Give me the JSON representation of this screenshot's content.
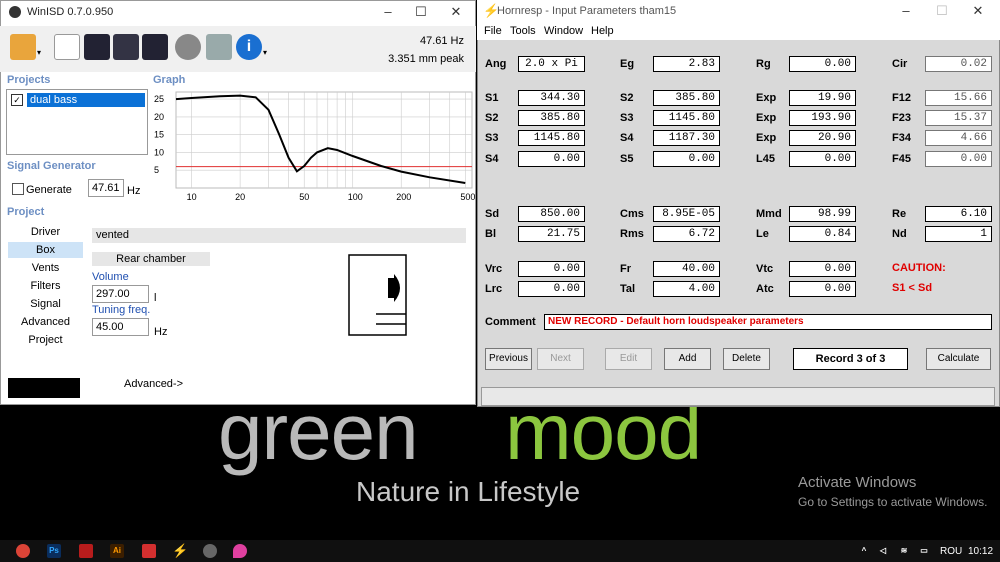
{
  "desktop": {
    "brand_grey": "green",
    "brand_green": "mood",
    "tagline": "Nature in Lifestyle",
    "activate_title": "Activate Windows",
    "activate_sub": "Go to Settings to activate Windows.",
    "accent_green": "#8cc63f"
  },
  "taskbar": {
    "language": "ROU",
    "time": "10:12",
    "icons": [
      "chrome-icon",
      "photoshop-icon",
      "autocad-icon",
      "illustrator-icon",
      "acrobat-icon",
      "hornresp-icon",
      "winisd-icon",
      "maps-icon"
    ]
  },
  "winisd": {
    "title": "WinISD 0.7.0.950",
    "freq_readout": "47.61 Hz",
    "peak_readout": "3.351 mm peak",
    "projects_label": "Projects",
    "graph_label": "Graph",
    "project_name": "dual bass",
    "signal_generator_label": "Signal Generator",
    "generate_label": "Generate",
    "generator_value": "47.61",
    "generator_unit": "Hz",
    "project_label": "Project",
    "nav": [
      "Driver",
      "Box",
      "Vents",
      "Filters",
      "Signal",
      "Advanced",
      "Project"
    ],
    "box_type": "vented",
    "rear_chamber": "Rear chamber",
    "volume_label": "Volume",
    "volume_value": "297.00",
    "volume_unit": "l",
    "tuning_label": "Tuning freq.",
    "tuning_value": "45.00",
    "tuning_unit": "Hz",
    "advanced_link": "Advanced->",
    "graph": {
      "y_ticks": [
        "25",
        "20",
        "15",
        "10",
        "5"
      ],
      "x_ticks": [
        "10",
        "20",
        "50",
        "100",
        "200",
        "500"
      ]
    }
  },
  "chart_data": {
    "type": "line",
    "title": "",
    "xlabel": "",
    "ylabel": "",
    "x_scale": "log",
    "xlim": [
      8,
      550
    ],
    "ylim": [
      0,
      27
    ],
    "grid": true,
    "series": [
      {
        "x": [
          8,
          10,
          15,
          20,
          25,
          30,
          35,
          40,
          45,
          50,
          55,
          60,
          70,
          80,
          100,
          150,
          200,
          300,
          500
        ],
        "values": [
          25,
          25.3,
          25.8,
          26,
          25.5,
          22,
          15,
          8.5,
          4.7,
          6.2,
          8.5,
          10,
          11.2,
          10.7,
          9,
          6.2,
          4.6,
          3,
          1.4
        ]
      }
    ],
    "reference_line": {
      "y": 6,
      "color": "#e03030"
    }
  },
  "hornresp": {
    "title": "Hornresp - Input Parameters   tham15",
    "menu": [
      "File",
      "Tools",
      "Window",
      "Help"
    ],
    "params": [
      {
        "label": "Ang",
        "value": "2.0 x Pi",
        "style": "left"
      },
      {
        "label": "Eg",
        "value": "2.83"
      },
      {
        "label": "Rg",
        "value": "0.00"
      },
      {
        "label": "Cir",
        "value": "0.02",
        "style": "grey"
      },
      {
        "label": "S1",
        "value": "344.30"
      },
      {
        "label": "S2",
        "value": "385.80"
      },
      {
        "label": "Exp",
        "value": "19.90"
      },
      {
        "label": "F12",
        "value": "15.66",
        "style": "grey"
      },
      {
        "label": "S2",
        "value": "385.80"
      },
      {
        "label": "S3",
        "value": "1145.80"
      },
      {
        "label": "Exp",
        "value": "193.90"
      },
      {
        "label": "F23",
        "value": "15.37",
        "style": "grey"
      },
      {
        "label": "S3",
        "value": "1145.80"
      },
      {
        "label": "S4",
        "value": "1187.30"
      },
      {
        "label": "Exp",
        "value": "20.90"
      },
      {
        "label": "F34",
        "value": "4.66",
        "style": "grey"
      },
      {
        "label": "S4",
        "value": "0.00"
      },
      {
        "label": "S5",
        "value": "0.00"
      },
      {
        "label": "L45",
        "value": "0.00"
      },
      {
        "label": "F45",
        "value": "0.00",
        "style": "grey"
      },
      {
        "label": "Sd",
        "value": "850.00"
      },
      {
        "label": "Cms",
        "value": "8.95E-05"
      },
      {
        "label": "Mmd",
        "value": "98.99"
      },
      {
        "label": "Re",
        "value": "6.10"
      },
      {
        "label": "Bl",
        "value": "21.75"
      },
      {
        "label": "Rms",
        "value": "6.72"
      },
      {
        "label": "Le",
        "value": "0.84"
      },
      {
        "label": "Nd",
        "value": "1"
      },
      {
        "label": "Vrc",
        "value": "0.00"
      },
      {
        "label": "Fr",
        "value": "40.00"
      },
      {
        "label": "Vtc",
        "value": "0.00"
      },
      {
        "label": "Lrc",
        "value": "0.00"
      },
      {
        "label": "Tal",
        "value": "4.00"
      },
      {
        "label": "Atc",
        "value": "0.00"
      }
    ],
    "caution_title": "CAUTION:",
    "caution_text": "S1 < Sd",
    "comment_label": "Comment",
    "comment_value": "NEW RECORD - Default horn loudspeaker parameters",
    "buttons": {
      "previous": "Previous",
      "next": "Next",
      "edit": "Edit",
      "add": "Add",
      "delete": "Delete",
      "calculate": "Calculate"
    },
    "record": "Record 3 of 3",
    "caution_color": "#e00000"
  }
}
